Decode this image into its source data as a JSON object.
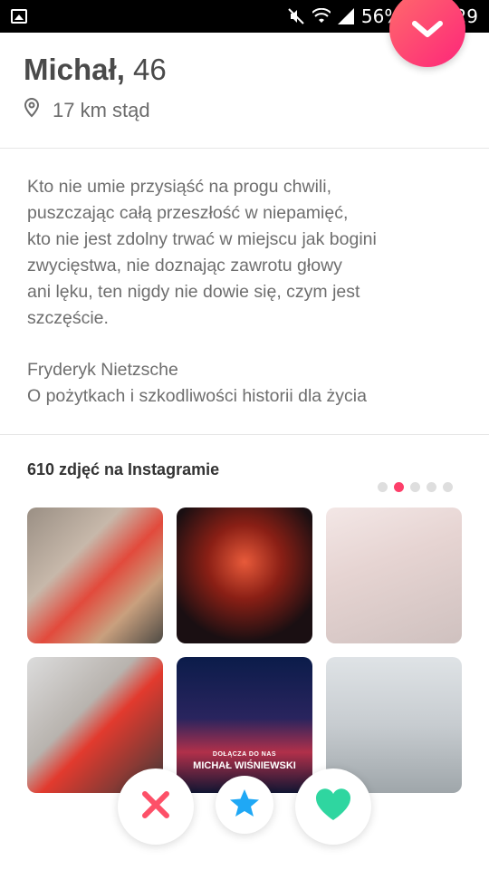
{
  "status_bar": {
    "battery": "56%",
    "time": "20:29",
    "icons": [
      "gallery-icon",
      "mute-icon",
      "wifi-icon",
      "signal-icon",
      "battery-icon"
    ]
  },
  "profile": {
    "name": "Michał,",
    "age": "46",
    "distance": "17 km stąd",
    "location_icon": "pin-icon"
  },
  "bio": {
    "lines": [
      "Kto nie umie przysiąść na progu chwili,",
      "puszczając całą przeszłość w niepamięć,",
      "kto nie jest zdolny trwać w miejscu jak bogini",
      "zwycięstwa, nie doznając zawrotu głowy",
      "ani lęku, ten nigdy nie dowie się, czym jest",
      "szczęście."
    ],
    "author": "Fryderyk Nietzsche",
    "source": "O pożytkach i szkodliwości historii dla życia"
  },
  "instagram": {
    "title": "610 zdjęć na Instagramie",
    "page_count": 5,
    "active_page": 2,
    "poster_small_text": "DOŁĄCZA DO NAS",
    "poster_name": "MICHAŁ WIŚNIEWSKI"
  },
  "actions": {
    "nope_icon": "x-icon",
    "superlike_icon": "star-icon",
    "like_icon": "heart-icon"
  },
  "colors": {
    "accent": "#fd3f6a",
    "nope": "#fd5068",
    "superlike": "#1fa8f5",
    "like": "#2fd6a0"
  }
}
